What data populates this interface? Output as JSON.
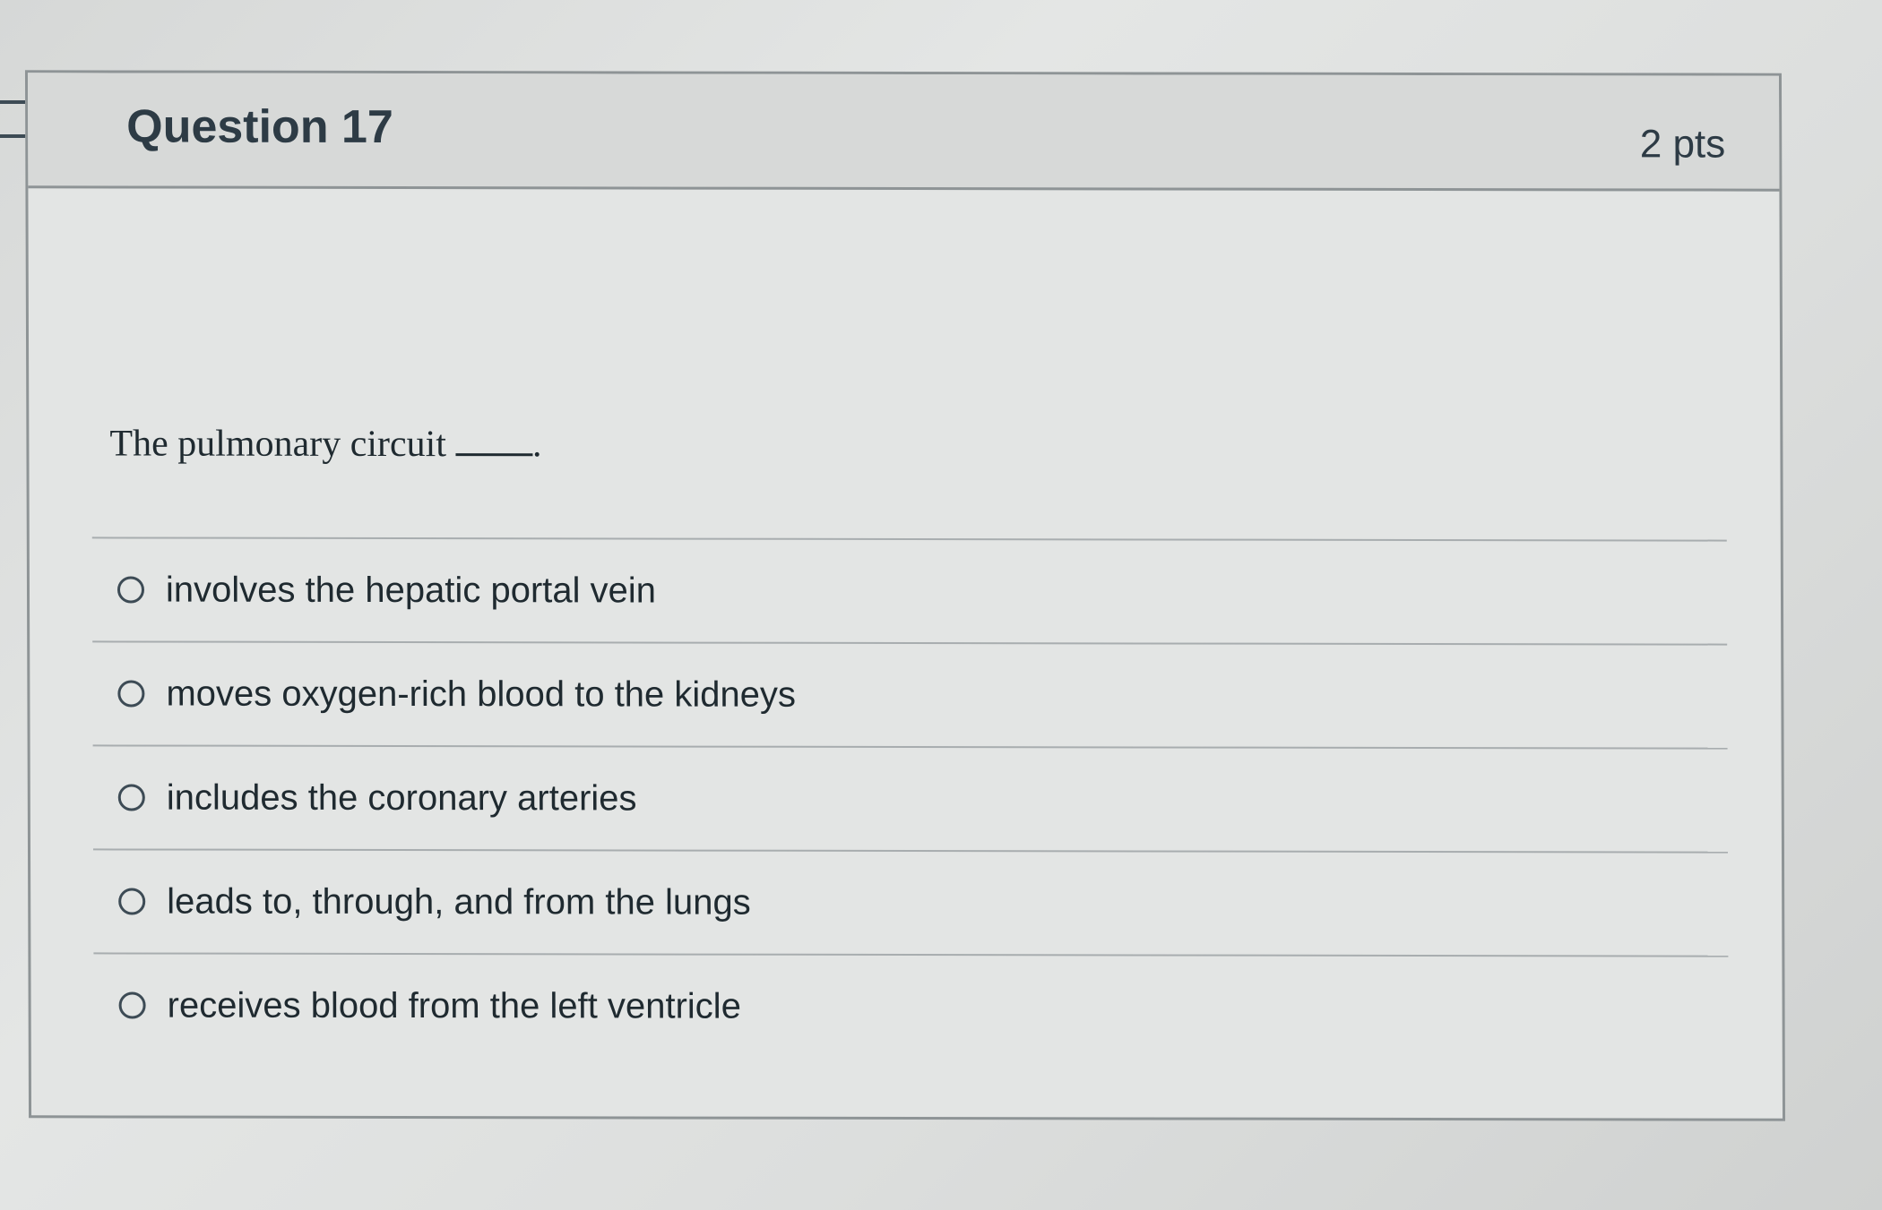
{
  "question": {
    "title": "Question 17",
    "points": "2 pts",
    "text": "The pulmonary circuit",
    "text_end": ".",
    "flag_icon": "bookmark-flag-icon"
  },
  "answers": [
    {
      "label": "involves the hepatic portal vein"
    },
    {
      "label": "moves oxygen-rich blood to the kidneys"
    },
    {
      "label": "includes the coronary arteries"
    },
    {
      "label": "leads to, through, and from the lungs"
    },
    {
      "label": "receives blood from the left ventricle"
    }
  ],
  "colors": {
    "text": "#2d3b45",
    "border": "#8e9496",
    "header_bg": "#d7d9d8"
  }
}
